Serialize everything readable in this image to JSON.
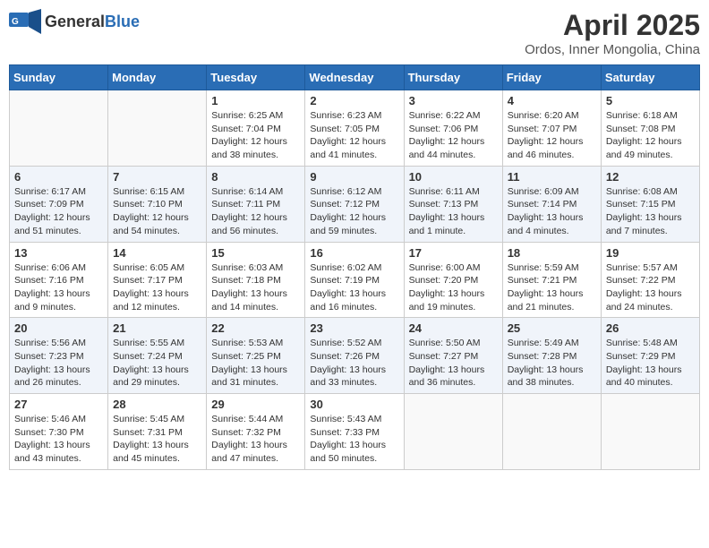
{
  "header": {
    "logo_general": "General",
    "logo_blue": "Blue",
    "month_year": "April 2025",
    "location": "Ordos, Inner Mongolia, China"
  },
  "weekdays": [
    "Sunday",
    "Monday",
    "Tuesday",
    "Wednesday",
    "Thursday",
    "Friday",
    "Saturday"
  ],
  "weeks": [
    [
      {
        "day": "",
        "info": ""
      },
      {
        "day": "",
        "info": ""
      },
      {
        "day": "1",
        "info": "Sunrise: 6:25 AM\nSunset: 7:04 PM\nDaylight: 12 hours\nand 38 minutes."
      },
      {
        "day": "2",
        "info": "Sunrise: 6:23 AM\nSunset: 7:05 PM\nDaylight: 12 hours\nand 41 minutes."
      },
      {
        "day": "3",
        "info": "Sunrise: 6:22 AM\nSunset: 7:06 PM\nDaylight: 12 hours\nand 44 minutes."
      },
      {
        "day": "4",
        "info": "Sunrise: 6:20 AM\nSunset: 7:07 PM\nDaylight: 12 hours\nand 46 minutes."
      },
      {
        "day": "5",
        "info": "Sunrise: 6:18 AM\nSunset: 7:08 PM\nDaylight: 12 hours\nand 49 minutes."
      }
    ],
    [
      {
        "day": "6",
        "info": "Sunrise: 6:17 AM\nSunset: 7:09 PM\nDaylight: 12 hours\nand 51 minutes."
      },
      {
        "day": "7",
        "info": "Sunrise: 6:15 AM\nSunset: 7:10 PM\nDaylight: 12 hours\nand 54 minutes."
      },
      {
        "day": "8",
        "info": "Sunrise: 6:14 AM\nSunset: 7:11 PM\nDaylight: 12 hours\nand 56 minutes."
      },
      {
        "day": "9",
        "info": "Sunrise: 6:12 AM\nSunset: 7:12 PM\nDaylight: 12 hours\nand 59 minutes."
      },
      {
        "day": "10",
        "info": "Sunrise: 6:11 AM\nSunset: 7:13 PM\nDaylight: 13 hours\nand 1 minute."
      },
      {
        "day": "11",
        "info": "Sunrise: 6:09 AM\nSunset: 7:14 PM\nDaylight: 13 hours\nand 4 minutes."
      },
      {
        "day": "12",
        "info": "Sunrise: 6:08 AM\nSunset: 7:15 PM\nDaylight: 13 hours\nand 7 minutes."
      }
    ],
    [
      {
        "day": "13",
        "info": "Sunrise: 6:06 AM\nSunset: 7:16 PM\nDaylight: 13 hours\nand 9 minutes."
      },
      {
        "day": "14",
        "info": "Sunrise: 6:05 AM\nSunset: 7:17 PM\nDaylight: 13 hours\nand 12 minutes."
      },
      {
        "day": "15",
        "info": "Sunrise: 6:03 AM\nSunset: 7:18 PM\nDaylight: 13 hours\nand 14 minutes."
      },
      {
        "day": "16",
        "info": "Sunrise: 6:02 AM\nSunset: 7:19 PM\nDaylight: 13 hours\nand 16 minutes."
      },
      {
        "day": "17",
        "info": "Sunrise: 6:00 AM\nSunset: 7:20 PM\nDaylight: 13 hours\nand 19 minutes."
      },
      {
        "day": "18",
        "info": "Sunrise: 5:59 AM\nSunset: 7:21 PM\nDaylight: 13 hours\nand 21 minutes."
      },
      {
        "day": "19",
        "info": "Sunrise: 5:57 AM\nSunset: 7:22 PM\nDaylight: 13 hours\nand 24 minutes."
      }
    ],
    [
      {
        "day": "20",
        "info": "Sunrise: 5:56 AM\nSunset: 7:23 PM\nDaylight: 13 hours\nand 26 minutes."
      },
      {
        "day": "21",
        "info": "Sunrise: 5:55 AM\nSunset: 7:24 PM\nDaylight: 13 hours\nand 29 minutes."
      },
      {
        "day": "22",
        "info": "Sunrise: 5:53 AM\nSunset: 7:25 PM\nDaylight: 13 hours\nand 31 minutes."
      },
      {
        "day": "23",
        "info": "Sunrise: 5:52 AM\nSunset: 7:26 PM\nDaylight: 13 hours\nand 33 minutes."
      },
      {
        "day": "24",
        "info": "Sunrise: 5:50 AM\nSunset: 7:27 PM\nDaylight: 13 hours\nand 36 minutes."
      },
      {
        "day": "25",
        "info": "Sunrise: 5:49 AM\nSunset: 7:28 PM\nDaylight: 13 hours\nand 38 minutes."
      },
      {
        "day": "26",
        "info": "Sunrise: 5:48 AM\nSunset: 7:29 PM\nDaylight: 13 hours\nand 40 minutes."
      }
    ],
    [
      {
        "day": "27",
        "info": "Sunrise: 5:46 AM\nSunset: 7:30 PM\nDaylight: 13 hours\nand 43 minutes."
      },
      {
        "day": "28",
        "info": "Sunrise: 5:45 AM\nSunset: 7:31 PM\nDaylight: 13 hours\nand 45 minutes."
      },
      {
        "day": "29",
        "info": "Sunrise: 5:44 AM\nSunset: 7:32 PM\nDaylight: 13 hours\nand 47 minutes."
      },
      {
        "day": "30",
        "info": "Sunrise: 5:43 AM\nSunset: 7:33 PM\nDaylight: 13 hours\nand 50 minutes."
      },
      {
        "day": "",
        "info": ""
      },
      {
        "day": "",
        "info": ""
      },
      {
        "day": "",
        "info": ""
      }
    ]
  ]
}
